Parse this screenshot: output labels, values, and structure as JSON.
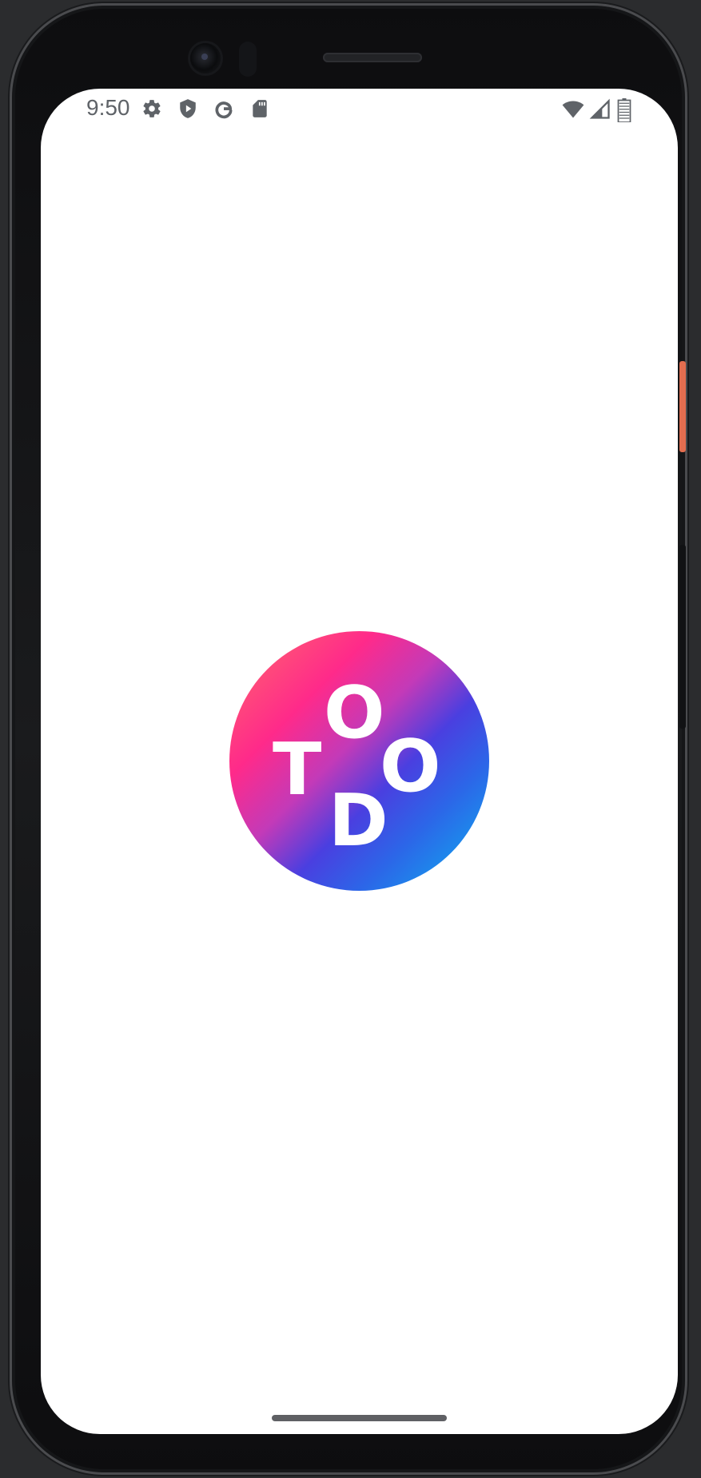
{
  "status_bar": {
    "time": "9:50",
    "left_icons": [
      "gear-icon",
      "shield-play-icon",
      "google-icon",
      "sd-card-icon"
    ],
    "right_icons": [
      "wifi-icon",
      "cell-signal-icon",
      "battery-icon"
    ]
  },
  "splash": {
    "logo_letters": {
      "t": "T",
      "o_top": "O",
      "o_right": "O",
      "d": "D"
    },
    "logo_colors": [
      "#ff6b6b",
      "#ff2a8a",
      "#4a3fe0",
      "#0ab5f0"
    ]
  }
}
